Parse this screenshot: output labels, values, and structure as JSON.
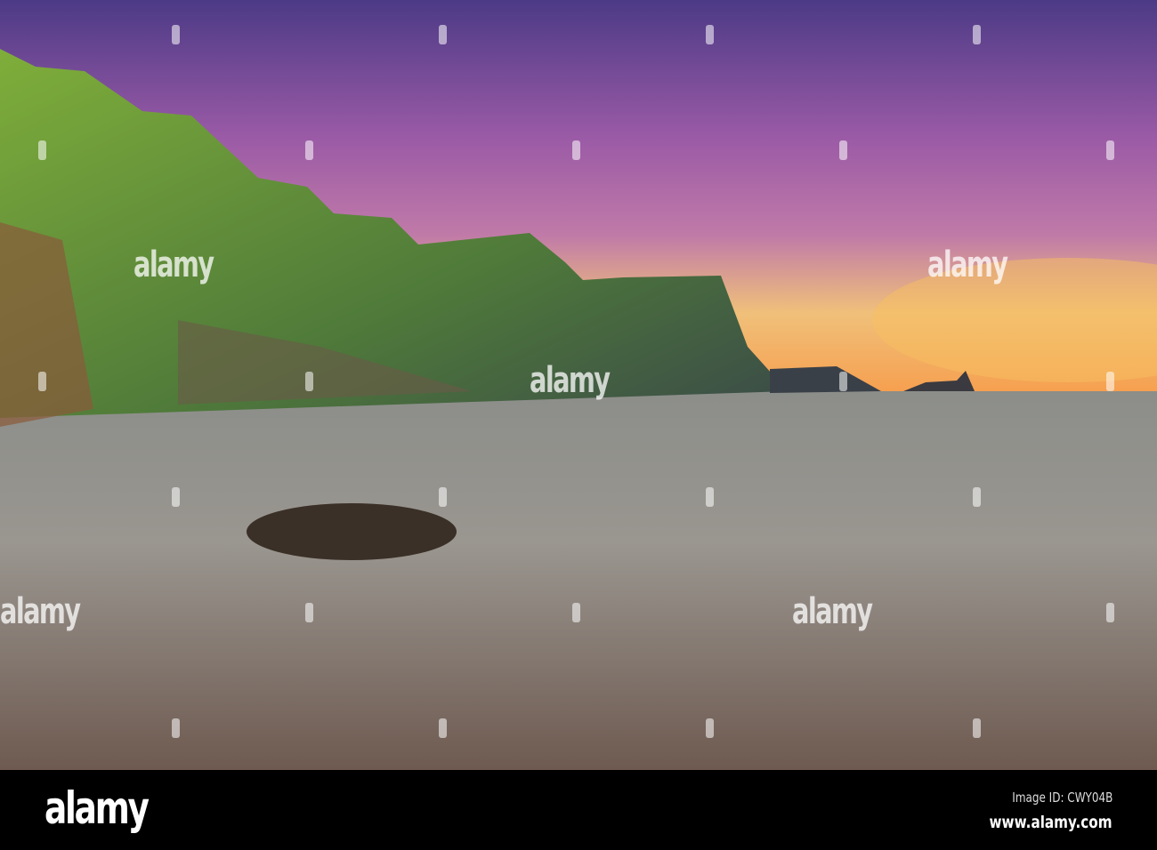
{
  "photo": {
    "subject": "Coastal cliffs at sunset with sea and rock",
    "colors": {
      "sky_top": "#5a3a8a",
      "sky_mid": "#b36aa8",
      "horizon": "#f5b55a",
      "cliff": "#6f9a3a",
      "sea": "#7a7a78"
    }
  },
  "watermark": {
    "text": "alamy"
  },
  "footer": {
    "logo": "alamy",
    "image_id": "Image ID: CWY04B",
    "website": "www.alamy.com"
  }
}
